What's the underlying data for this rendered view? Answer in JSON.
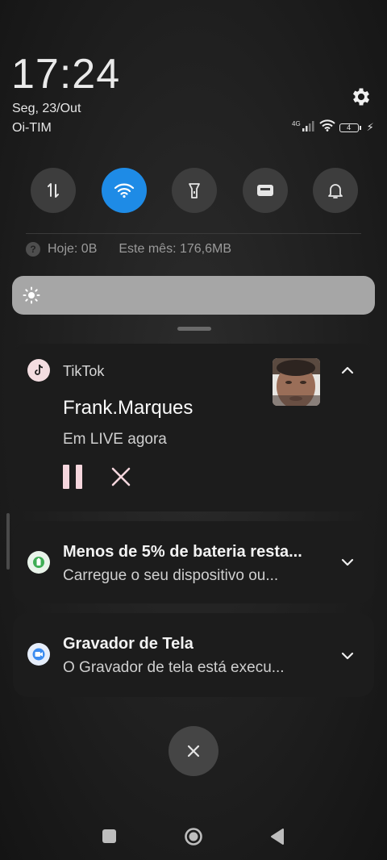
{
  "status": {
    "time": "17:24",
    "date": "Seg, 23/Out",
    "carrier": "Oi-TIM",
    "network": "4G",
    "battery_level": "4"
  },
  "quick_settings": {
    "tiles": [
      {
        "icon": "mobile-data-icon",
        "active": false
      },
      {
        "icon": "wifi-icon",
        "active": true
      },
      {
        "icon": "flashlight-icon",
        "active": false
      },
      {
        "icon": "cast-icon",
        "active": false
      },
      {
        "icon": "bell-icon",
        "active": false
      }
    ],
    "data_today": "Hoje: 0B",
    "data_month": "Este mês: 176,6MB",
    "accent_color": "#1e8be6"
  },
  "notifications": [
    {
      "app": "TikTok",
      "title": "Frank.Marques",
      "text": "Em LIVE agora",
      "icon": "tiktok-icon",
      "accent": "#f5d6dd"
    },
    {
      "title": "Menos de 5% de bateria resta...",
      "text": "Carregue o seu dispositivo ou...",
      "icon": "battery-saver-icon"
    },
    {
      "title": "Gravador de Tela",
      "text": "O Gravador de tela está execu...",
      "icon": "screen-recorder-icon"
    }
  ]
}
